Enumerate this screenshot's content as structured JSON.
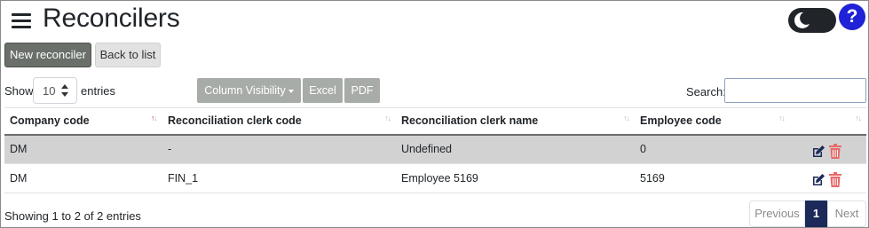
{
  "header": {
    "title": "Reconcilers",
    "help_label": "?"
  },
  "toolbar": {
    "new_label": "New reconciler",
    "back_label": "Back to list"
  },
  "controls": {
    "show_label": "Show",
    "entries_value": "10",
    "entries_label": "entries",
    "column_visibility_label": "Column Visibility",
    "excel_label": "Excel",
    "pdf_label": "PDF",
    "search_label": "Search:",
    "search_value": ""
  },
  "table": {
    "columns": [
      "Company code",
      "Reconciliation clerk code",
      "Reconciliation clerk name",
      "Employee code",
      ""
    ],
    "rows": [
      [
        "DM",
        "-",
        "Undefined",
        "0"
      ],
      [
        "DM",
        "FIN_1",
        "Employee 5169",
        "5169"
      ]
    ]
  },
  "footer": {
    "info": "Showing 1 to 2 of 2 entries",
    "prev_label": "Previous",
    "current_page": "1",
    "next_label": "Next"
  },
  "colors": {
    "primary_button": "#6a6f6a",
    "help": "#1f22d6",
    "active_page": "#1c2a5a",
    "edit_icon": "#1c2a5a",
    "delete_icon": "#e86a6a"
  },
  "icons": {
    "menu": "hamburger-icon",
    "theme": "moon-icon",
    "edit": "edit-icon",
    "delete": "trash-icon"
  }
}
